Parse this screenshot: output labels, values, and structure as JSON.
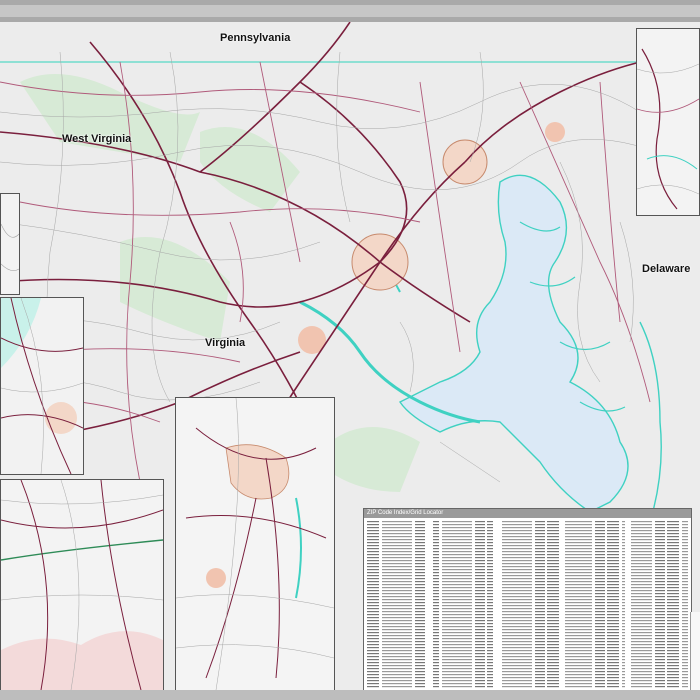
{
  "map": {
    "state_labels": {
      "pennsylvania": "Pennsylvania",
      "west_virginia": "West Virginia",
      "virginia": "Virginia",
      "delaware": "Delaware"
    },
    "index_title": "ZIP Code Index/Grid Locator",
    "colors": {
      "land": "#ececec",
      "water": "#dbe9f6",
      "shore": "#3fd1c2",
      "interstate": "#7a1f3d",
      "highway": "#b05a7a",
      "local_road": "#9c9c9c",
      "metro_area": "#f3c9b4",
      "forest": "#cfe6cf"
    }
  }
}
